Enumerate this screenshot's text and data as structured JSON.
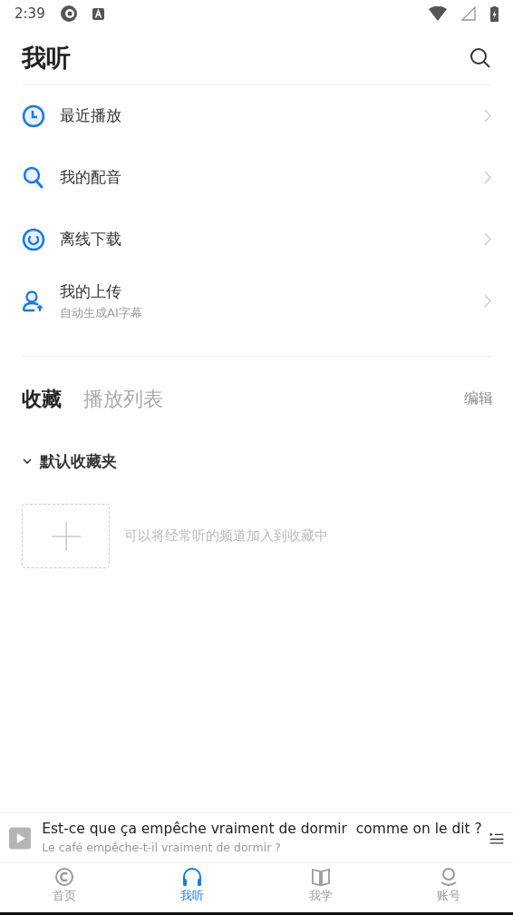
{
  "status_bar": {
    "time": "2:39"
  },
  "header": {
    "title": "我听"
  },
  "menu": [
    {
      "label": "最近播放"
    },
    {
      "label": "我的配音"
    },
    {
      "label": "离线下载"
    },
    {
      "label": "我的上传",
      "subtitle": "自动生成AI字幕"
    }
  ],
  "tabs": [
    {
      "label": "收藏",
      "selected": true
    },
    {
      "label": "播放列表",
      "selected": false
    }
  ],
  "edit_button": "编辑",
  "folder": {
    "name": "默认收藏夹",
    "expanded": true,
    "empty_hint": "可以将经常听的频道加入到收藏中"
  },
  "player": {
    "title": "Est-ce que ça empêche vraiment de dormir  comme on le dit ?",
    "subtitle": "Le café empêche-t-il vraiment de dormir ?"
  },
  "bottom_nav": [
    {
      "label": "首页",
      "selected": false
    },
    {
      "label": "我听",
      "selected": true
    },
    {
      "label": "我学",
      "selected": false
    },
    {
      "label": "账号",
      "selected": false
    }
  ]
}
